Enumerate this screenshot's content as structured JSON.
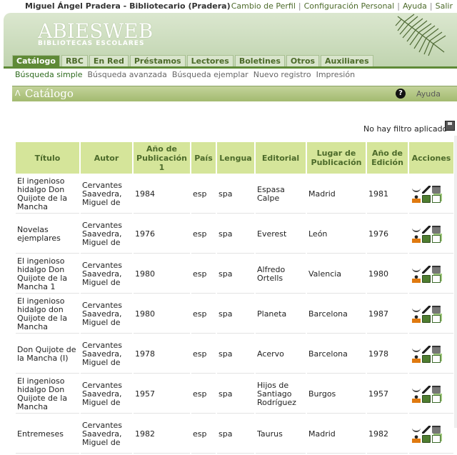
{
  "topbar": {
    "user": "Miguel Ángel Pradera - Bibliotecario (Pradera)",
    "links": [
      "Cambio de Perfil",
      "Configuración Personal",
      "Ayuda",
      "Salir"
    ]
  },
  "logo": {
    "name": "ABIESWEB",
    "subtitle": "BIBLIOTECAS ESCOLARES"
  },
  "tabs": [
    "Catálogo",
    "RBC",
    "En Red",
    "Préstamos",
    "Lectores",
    "Boletines",
    "Otros",
    "Auxiliares"
  ],
  "subnav": [
    "Búsqueda simple",
    "Búsqueda avanzada",
    "Búsqueda ejemplar",
    "Nuevo registro",
    "Impresión"
  ],
  "section": {
    "title": "Catálogo",
    "help": "Ayuda"
  },
  "filter": "No hay filtro aplicado",
  "table": {
    "headers": [
      "Título",
      "Autor",
      "Año de Publicación 1",
      "País",
      "Lengua",
      "Editorial",
      "Lugar de Publicación",
      "Año de Edición",
      "Acciones"
    ],
    "rows": [
      [
        "El ingenioso hidalgo Don Quijote de la Mancha",
        "Cervantes Saavedra, Miguel de",
        "1984",
        "esp",
        "spa",
        "Espasa Calpe",
        "Madrid",
        "1981"
      ],
      [
        "Novelas ejemplares",
        "Cervantes Saavedra, Miguel de",
        "1976",
        "esp",
        "spa",
        "Everest",
        "León",
        "1976"
      ],
      [
        "El ingenioso hidalgo Don Quijote de la Mancha 1",
        "Cervantes Saavedra, Miguel de",
        "1980",
        "esp",
        "spa",
        "Alfredo Ortells",
        "Valencia",
        "1980"
      ],
      [
        "El ingenioso hidalgo don Quijote de la Mancha",
        "Cervantes Saavedra, Miguel de",
        "1980",
        "esp",
        "spa",
        "Planeta",
        "Barcelona",
        "1987"
      ],
      [
        "Don Quijote de la Mancha (I)",
        "Cervantes Saavedra, Miguel de",
        "1978",
        "esp",
        "spa",
        "Acervo",
        "Barcelona",
        "1978"
      ],
      [
        "El ingenioso hidalgo Don Quijote de la Mancha",
        "Cervantes Saavedra, Miguel de",
        "1957",
        "esp",
        "spa",
        "Hijos de Santiago Rodríguez",
        "Burgos",
        "1957"
      ],
      [
        "Entremeses",
        "Cervantes Saavedra, Miguel de",
        "1982",
        "esp",
        "spa",
        "Taurus",
        "Madrid",
        "1982"
      ]
    ]
  },
  "icons": [
    "glasses-icon",
    "pen-icon",
    "trash-icon",
    "person-icon",
    "book-icon",
    "copy-icon"
  ]
}
